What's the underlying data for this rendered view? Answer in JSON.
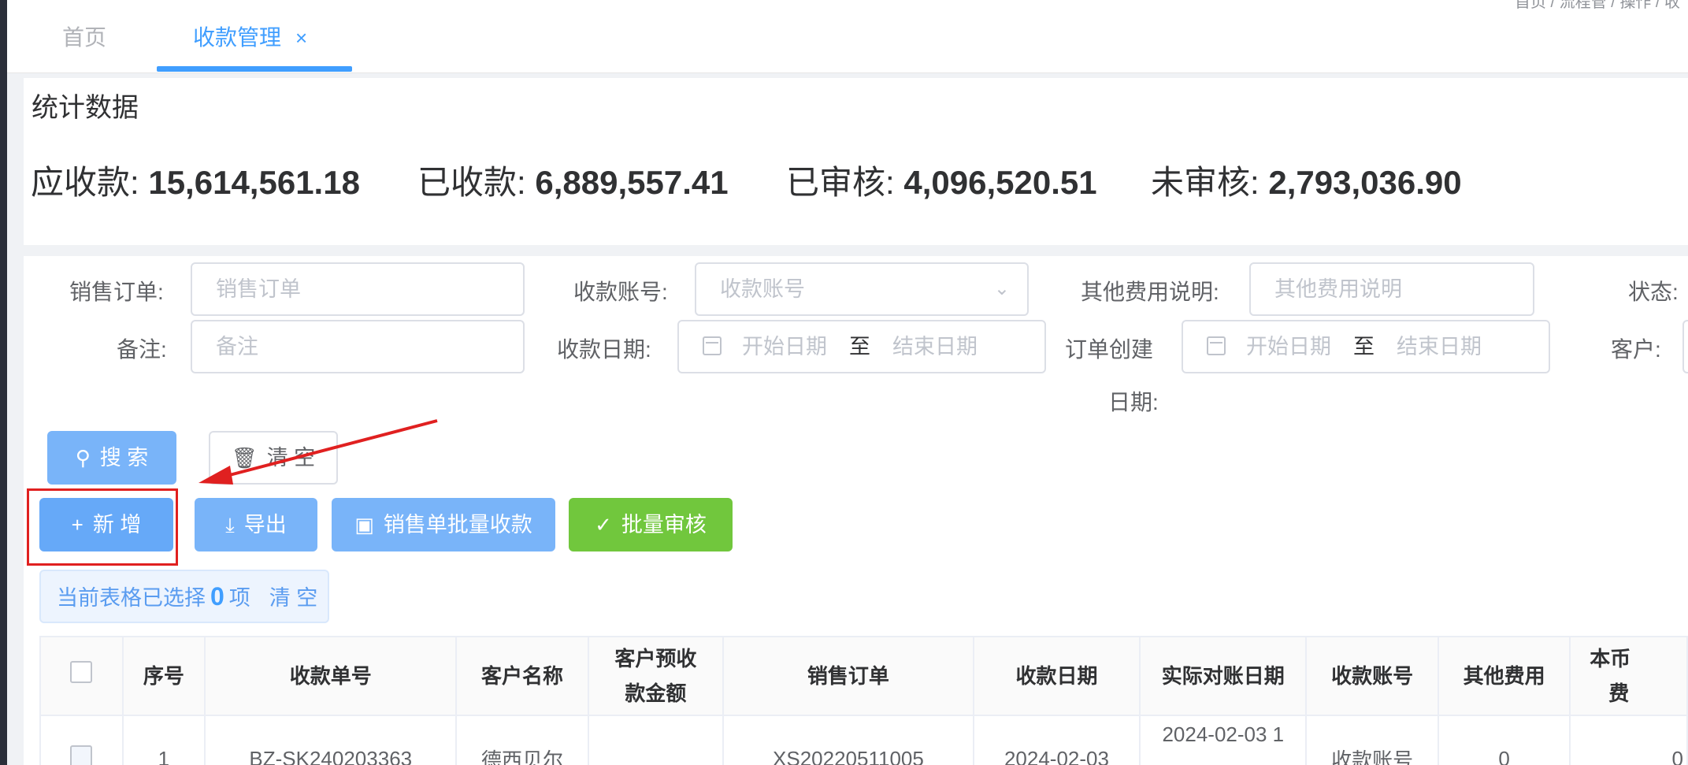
{
  "tabs": {
    "home": "首页",
    "active": "收款管理",
    "close": "×",
    "top_clip": "首页 / 流程管 / 操作 / 收"
  },
  "stats": {
    "title": "统计数据",
    "receivable_label": "应收款:",
    "receivable_value": "15,614,561.18",
    "received_label": "已收款:",
    "received_value": "6,889,557.41",
    "audited_label": "已审核:",
    "audited_value": "4,096,520.51",
    "unaudited_label": "未审核:",
    "unaudited_value": "2,793,036.90"
  },
  "filters": {
    "sales_order_label": "销售订单:",
    "sales_order_placeholder": "销售订单",
    "account_label": "收款账号:",
    "account_placeholder": "收款账号",
    "other_fee_label": "其他费用说明:",
    "other_fee_placeholder": "其他费用说明",
    "status_label": "状态:",
    "remark_label": "备注:",
    "remark_placeholder": "备注",
    "receipt_date_label": "收款日期:",
    "start_date": "开始日期",
    "to": "至",
    "end_date": "结束日期",
    "order_create_label_1": "订单创建",
    "order_create_label_2": "日期:",
    "customer_label": "客户:"
  },
  "buttons": {
    "search": "搜 索",
    "clear": "清 空",
    "add": "新 增",
    "export": "导出",
    "batch_collect": "销售单批量收款",
    "batch_audit": "批量审核"
  },
  "selection": {
    "prefix": "当前表格已选择",
    "count": "0",
    "suffix": "项",
    "clear": "清 空"
  },
  "table": {
    "headers": {
      "index": "序号",
      "receipt_no": "收款单号",
      "customer": "客户名称",
      "prepay_1": "客户预收",
      "prepay_2": "款金额",
      "sales_order": "销售订单",
      "receipt_date": "收款日期",
      "actual_date": "实际对账日期",
      "account": "收款账号",
      "other_fee": "其他费用",
      "local_fee_1": "本币",
      "local_fee_2": "费"
    },
    "rows": [
      {
        "index": "1",
        "receipt_no": "BZ-SK240203363",
        "customer": "德西贝尔",
        "prepay": "",
        "sales_order": "XS20220511005",
        "receipt_date": "2024-02-03",
        "actual_date": "2024-02-03 1",
        "account": "收款账号",
        "other_fee": "0",
        "local_fee": "0"
      }
    ]
  },
  "colors": {
    "primary": "#409eff",
    "success": "#71c73d",
    "annotation": "#e02020"
  },
  "icons": {
    "search": "search-icon",
    "clear": "trash-icon",
    "add": "plus-icon",
    "export": "download-icon",
    "batch_collect": "wallet-icon",
    "batch_audit": "check-icon",
    "calendar": "calendar-icon",
    "dropdown": "chevron-down-icon"
  }
}
